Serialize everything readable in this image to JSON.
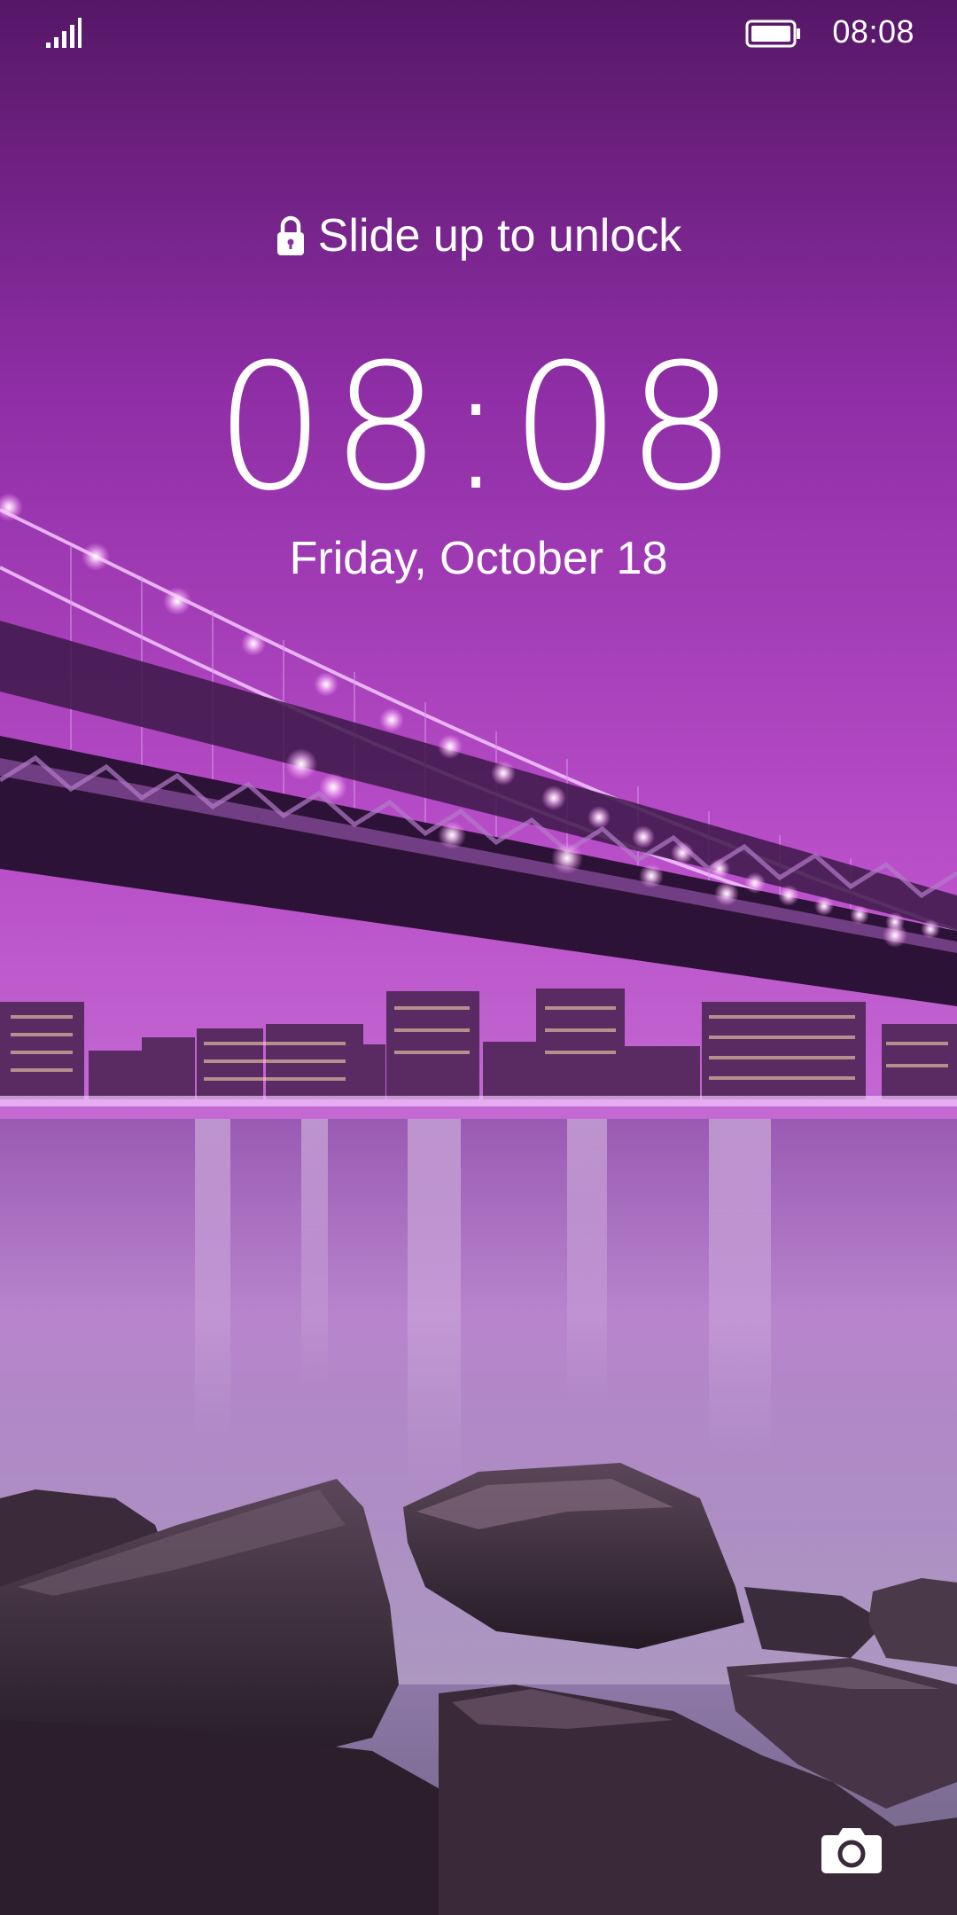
{
  "status_bar": {
    "time": "08:08",
    "signal_icon": "signal-bars-icon",
    "battery_icon": "battery-full-icon"
  },
  "lock_screen": {
    "unlock_hint": "Slide up to unlock",
    "lock_icon": "lock-icon",
    "clock": "08:08",
    "date": "Friday, October 18",
    "camera_icon": "camera-icon"
  },
  "wallpaper": {
    "sky_top": "#5e1a6b",
    "sky_mid": "#a839c0",
    "sky_horizon": "#c25dd0",
    "water_light": "#b77ac8",
    "water_dark": "#4b3c5e",
    "rock_color": "#3a2d38",
    "bridge_color": "#34173f",
    "light_color": "#ffe6ff"
  }
}
